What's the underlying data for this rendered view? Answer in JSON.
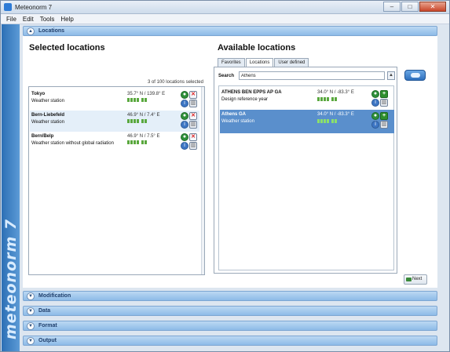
{
  "window": {
    "title": "Meteonorm 7"
  },
  "menu": [
    "File",
    "Edit",
    "Tools",
    "Help"
  ],
  "brand": "meteonorm 7",
  "sections": {
    "locations": "Locations",
    "modification": "Modification",
    "data": "Data",
    "format": "Format",
    "output": "Output"
  },
  "selected": {
    "title": "Selected locations",
    "count": "3 of 100 locations selected",
    "items": [
      {
        "name": "Tokyo",
        "type": "Weather station",
        "coords": "35.7° N / 139.8° E"
      },
      {
        "name": "Bern-Liebefeld",
        "type": "Weather station",
        "coords": "46.9° N / 7.4° E"
      },
      {
        "name": "Bern/Belp",
        "type": "Weather station without global radiation",
        "coords": "46.9° N / 7.5° E"
      }
    ]
  },
  "available": {
    "title": "Available locations",
    "tabs": [
      "Favorites",
      "Locations",
      "User defined"
    ],
    "active_tab": "Locations",
    "search_label": "Search",
    "search_value": "Athens",
    "items": [
      {
        "name": "ATHENS BEN EPPS AP GA",
        "type": "Design reference year",
        "coords": "34.0° N / -83.3° E"
      },
      {
        "name": "Athens GA",
        "type": "Weather station",
        "coords": "34.0° N / -83.3° E"
      }
    ]
  },
  "buttons": {
    "next": "Next"
  },
  "icons": {
    "edit": "globe-icon",
    "delete": "delete-x-icon",
    "info": "info-icon",
    "chart": "chart-icon",
    "add": "plus-icon",
    "search": "search-icon",
    "go": "go-arrow-icon"
  },
  "colors": {
    "accent": "#5a8fcc",
    "sidebar": "#2c6fb5",
    "quality_bar": "#5aa83e"
  }
}
